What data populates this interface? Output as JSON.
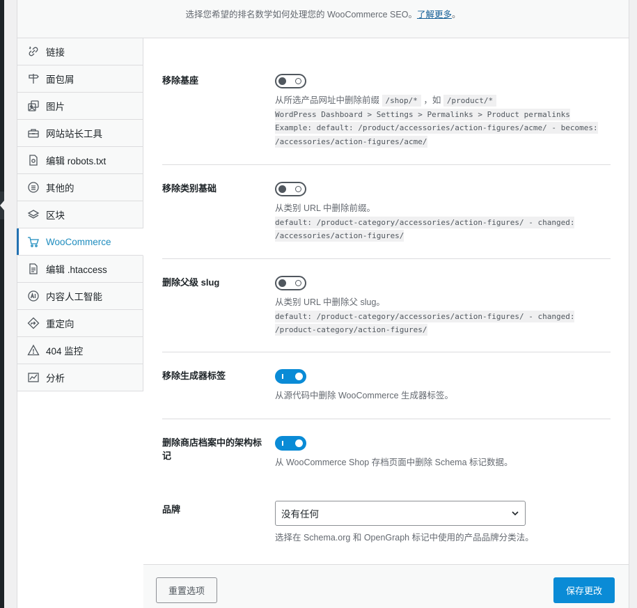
{
  "header": {
    "text": "选择您希望的排名数学如何处理您的 WooCommerce SEO。",
    "link": "了解更多",
    "tail": "。"
  },
  "sidebar": {
    "items": [
      {
        "label": "链接",
        "icon": "link-icon"
      },
      {
        "label": "面包屑",
        "icon": "signpost-icon"
      },
      {
        "label": "图片",
        "icon": "images-icon"
      },
      {
        "label": "网站站长工具",
        "icon": "toolbox-icon"
      },
      {
        "label": "编辑 robots.txt",
        "icon": "robots-file-icon"
      },
      {
        "label": "其他的",
        "icon": "misc-list-icon"
      },
      {
        "label": "区块",
        "icon": "blocks-icon"
      },
      {
        "label": "WooCommerce",
        "icon": "cart-icon",
        "active": true
      },
      {
        "label": "编辑 .htaccess",
        "icon": "htaccess-file-icon"
      },
      {
        "label": "内容人工智能",
        "icon": "ai-icon"
      },
      {
        "label": "重定向",
        "icon": "redirect-icon"
      },
      {
        "label": "404 监控",
        "icon": "warning-icon"
      },
      {
        "label": "分析",
        "icon": "analytics-icon"
      }
    ]
  },
  "settings": {
    "remove_base": {
      "label": "移除基座",
      "enabled": false,
      "desc_prefix": "从所选产品网址中删除前缀",
      "code1": "/shop/*",
      "desc_mid": "，如",
      "code2": "/product/*",
      "path": " WordPress Dashboard > Settings > Permalinks > Product permalinks ",
      "example1": "Example: default: /product/accessories/action-figures/acme/ - becomes:",
      "example2": "/accessories/action-figures/acme/ "
    },
    "remove_category_base": {
      "label": "移除类别基础",
      "enabled": false,
      "desc": "从类别 URL 中删除前缀。",
      "code1": " default: /product-category/accessories/action-figures/ - changed:",
      "code2": "/accessories/action-figures/ "
    },
    "remove_parent_slug": {
      "label": "删除父级 slug",
      "enabled": false,
      "desc": "从类别 URL 中删除父 slug。",
      "code1": " default: /product-category/accessories/action-figures/ - changed:",
      "code2": "/product-category/action-figures/ "
    },
    "remove_generator": {
      "label": "移除生成器标签",
      "enabled": true,
      "desc": "从源代码中删除 WooCommerce 生成器标签。"
    },
    "remove_schema": {
      "label": "删除商店档案中的架构标记",
      "enabled": true,
      "desc": "从 WooCommerce Shop 存档页面中删除 Schema 标记数据。"
    },
    "brand": {
      "label": "品牌",
      "selected": "没有任何",
      "desc": "选择在 Schema.org 和 OpenGraph 标记中使用的产品品牌分类法。"
    }
  },
  "footer": {
    "reset_label": "重置选项",
    "save_label": "保存更改"
  },
  "colors": {
    "accent": "#0a8bd6",
    "active_nav": "#1e8cbe"
  }
}
